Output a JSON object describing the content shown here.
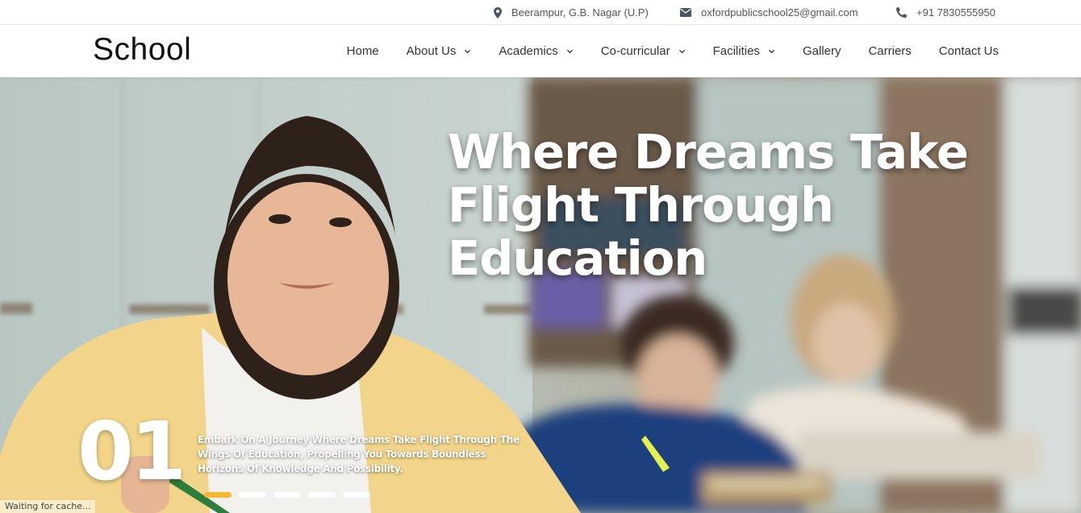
{
  "topbar": {
    "address": "Beerampur, G.B. Nagar (U.P)",
    "email": "oxfordpublicschool25@gmail.com",
    "phone": "+91 7830555950"
  },
  "navbar": {
    "logo": "School",
    "items": [
      {
        "label": "Home",
        "dropdown": false
      },
      {
        "label": "About Us",
        "dropdown": true
      },
      {
        "label": "Academics",
        "dropdown": true
      },
      {
        "label": "Co-curricular",
        "dropdown": true
      },
      {
        "label": "Facilities",
        "dropdown": true
      },
      {
        "label": "Gallery",
        "dropdown": false
      },
      {
        "label": "Carriers",
        "dropdown": false
      },
      {
        "label": "Contact Us",
        "dropdown": false
      }
    ]
  },
  "hero": {
    "title_line1": "Where Dreams Take",
    "title_line2": "Flight Through",
    "title_line3": "Education",
    "slide_number": "01",
    "slide_text": "Embark On A Journey Where Dreams Take Flight Through The Wings Of Education, Propelling You Towards Boundless Horizons Of Knowledge And Possibility.",
    "dots_count": 5,
    "active_dot": 0
  },
  "status": "Waiting for cache...",
  "colors": {
    "accent": "#f5b82e",
    "icon": "#4a5560"
  },
  "icons": {
    "address": "map-marker-icon",
    "email": "envelope-icon",
    "phone": "phone-icon",
    "dropdown": "chevron-down-icon"
  }
}
